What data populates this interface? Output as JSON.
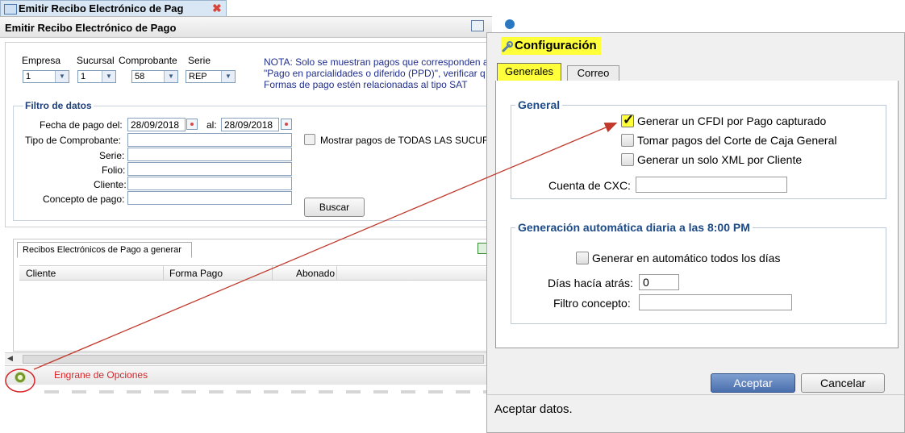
{
  "tab": {
    "title": "Emitir Recibo Electrónico de Pag",
    "close": "✖"
  },
  "window": {
    "title": "Emitir Recibo Electrónico de Pago"
  },
  "header": {
    "empresa_label": "Empresa",
    "empresa_value": "1",
    "sucursal_label": "Sucursal",
    "sucursal_value": "1",
    "comprobante_label": "Comprobante",
    "comprobante_value": "58",
    "serie_label": "Serie",
    "serie_value": "REP",
    "note_lines": [
      "NOTA: Solo se muestran pagos que corresponden a",
      "\"Pago en parcialidades o diferido (PPD)\", verificar q",
      "Formas de pago estén relacionadas al tipo SAT"
    ]
  },
  "filtro": {
    "title": "Filtro de datos",
    "fecha_label": "Fecha de pago del:",
    "fecha_del": "28/09/2018",
    "al_label": "al:",
    "fecha_al": "28/09/2018",
    "tipo_label": "Tipo de Comprobante:",
    "mostrar_label": "Mostrar pagos de TODAS LAS SUCURS",
    "serie_label": "Serie:",
    "folio_label": "Folio:",
    "cliente_label": "Cliente:",
    "concepto_label": "Concepto de pago:",
    "buscar_label": "Buscar"
  },
  "grid": {
    "tab_label": "Recibos Electrónicos de Pago a generar",
    "columns": [
      "Cliente",
      "Forma Pago",
      "Abonado"
    ]
  },
  "annotation": {
    "label": "Engrane de Opciones"
  },
  "dialog": {
    "title": "Configuración",
    "tabs": [
      "Generales",
      "Correo"
    ],
    "general": {
      "title": "General",
      "check1": "Generar un CFDI por Pago capturado",
      "check1_checked": "✓",
      "check2": "Tomar pagos del Corte de Caja General",
      "check3": "Generar un solo XML por Cliente",
      "cuenta_label": "Cuenta de CXC:",
      "cuenta_value": ""
    },
    "auto": {
      "title": "Generación automática diaria a las 8:00 PM",
      "check": "Generar en automático todos los días",
      "dias_label": "Días hacía atrás:",
      "dias_value": "0",
      "filtro_label": "Filtro concepto:",
      "filtro_value": ""
    },
    "ok_label": "Aceptar",
    "cancel_label": "Cancelar",
    "status": "Aceptar datos."
  },
  "colors": {
    "highlight": "#ffff3a",
    "arrow": "#c0392b",
    "note": "#22308c"
  },
  "icons": [
    "window-icon",
    "close-icon",
    "calendar-icon",
    "gear-icon",
    "wrench-icon",
    "print-icon",
    "export-icon",
    "help-icon",
    "checkmark-icon"
  ]
}
